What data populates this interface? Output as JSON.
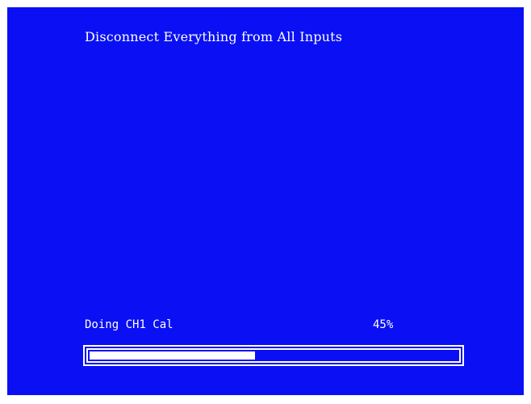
{
  "screen": {
    "instruction": "Disconnect Everything from All Inputs",
    "status": "Doing CH1 Cal",
    "percent_label": "45%",
    "progress_value": 0.45,
    "colors": {
      "background": "#0a10f3",
      "foreground": "#ffffff"
    }
  }
}
